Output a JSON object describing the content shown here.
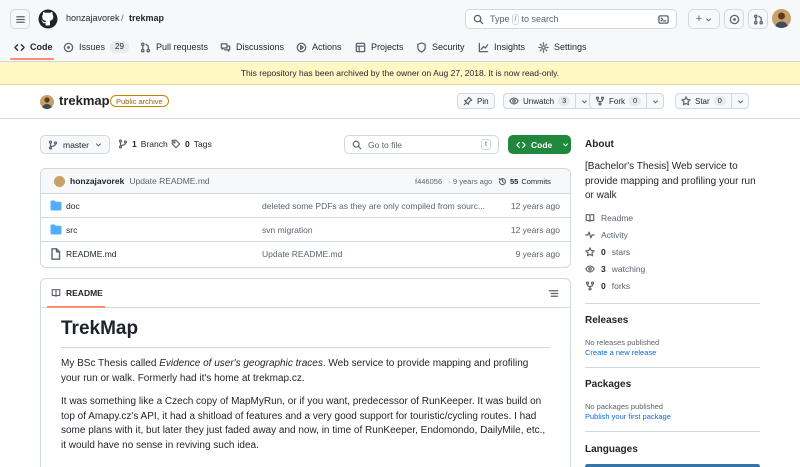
{
  "header": {
    "owner": "honzajavorek",
    "separator": "/",
    "repo": "trekmap",
    "search_prefix": "Type",
    "search_key": "/",
    "search_suffix": "to search",
    "plus_label": "+"
  },
  "nav": {
    "tabs": [
      {
        "label": "Code"
      },
      {
        "label": "Issues",
        "count": "29"
      },
      {
        "label": "Pull requests"
      },
      {
        "label": "Discussions"
      },
      {
        "label": "Actions"
      },
      {
        "label": "Projects"
      },
      {
        "label": "Security"
      },
      {
        "label": "Insights"
      },
      {
        "label": "Settings"
      }
    ]
  },
  "banner": {
    "text": "This repository has been archived by the owner on Aug 27, 2018. It is now read-only."
  },
  "repo": {
    "name": "trekmap",
    "visibility": "Public archive",
    "pin_label": "Pin",
    "unwatch_label": "Unwatch",
    "watch_count": "3",
    "fork_label": "Fork",
    "fork_count": "0",
    "star_label": "Star",
    "star_count": "0"
  },
  "toolbar": {
    "branch": "master",
    "branches_count": "1",
    "branches_label": "Branch",
    "tags_count": "0",
    "tags_label": "Tags",
    "goto_placeholder": "Go to file",
    "goto_key": "t",
    "code_label": "Code"
  },
  "commit": {
    "author": "honzajavorek",
    "message": "Update README.md",
    "hash": "f446056",
    "dot": "·",
    "age": "9 years ago",
    "commits_count": "55",
    "commits_label": "Commits"
  },
  "files": [
    {
      "type": "dir",
      "name": "doc",
      "message": "deleted some PDFs as they are only compiled from sourc...",
      "age": "12 years ago"
    },
    {
      "type": "dir",
      "name": "src",
      "message": "svn migration",
      "age": "12 years ago"
    },
    {
      "type": "file",
      "name": "README.md",
      "message": "Update README.md",
      "age": "9 years ago"
    }
  ],
  "readme": {
    "tab_label": "README",
    "title": "TrekMap",
    "p1_pre": "My BSc Thesis called ",
    "p1_em": "Evidence of user's geographic traces",
    "p1_post": ". Web service to provide mapping and profiling your run or walk. Formerly had it's home at trekmap.cz.",
    "p2": "It was something like a Czech copy of MapMyRun, or if you want, predecessor of RunKeeper. It was build on top of Amapy.cz's API, it had a shitload of features and a very good support for touristic/cycling routes. I had some plans with it, but later they just faded away and now, in time of RunKeeper, Endomondo, DailyMile, etc., it would have no sense in reviving such idea."
  },
  "sidebar": {
    "about_title": "About",
    "about_text": "[Bachelor's Thesis] Web service to provide mapping and profiling your run or walk",
    "readme_label": "Readme",
    "activity_label": "Activity",
    "stars_count": "0",
    "stars_label": "stars",
    "watching_count": "3",
    "watching_label": "watching",
    "forks_count": "0",
    "forks_label": "forks",
    "releases_title": "Releases",
    "releases_empty": "No releases published",
    "releases_link": "Create a new release",
    "packages_title": "Packages",
    "packages_empty": "No packages published",
    "packages_link": "Publish your first package",
    "languages_title": "Languages"
  },
  "colors": {
    "accent_green": "#1f883d",
    "banner_bg": "#fff8c5",
    "folder": "#54aeff",
    "link": "#0969da"
  }
}
